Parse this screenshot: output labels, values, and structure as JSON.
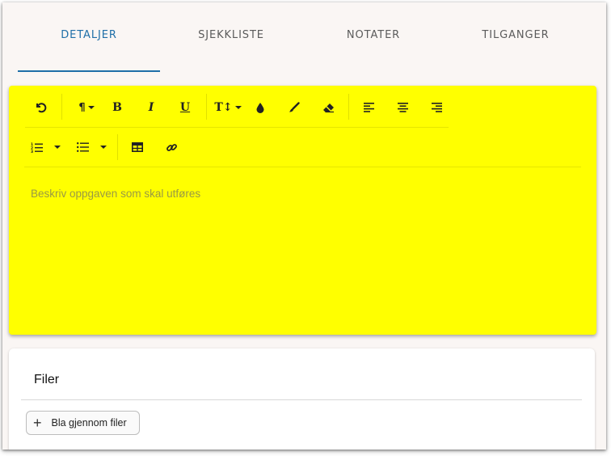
{
  "tabs": [
    {
      "label": "DETALJER",
      "active": true
    },
    {
      "label": "SJEKKLISTE",
      "active": false
    },
    {
      "label": "NOTATER",
      "active": false
    },
    {
      "label": "TILGANGER",
      "active": false
    }
  ],
  "editor": {
    "background": "#ffff00",
    "placeholder": "Beskriv oppgaven som skal utføres",
    "toolbar": {
      "row1": [
        "undo-icon",
        "paragraph-icon",
        "bold-icon",
        "italic-icon",
        "underline-icon",
        "font-size-icon",
        "text-color-icon",
        "highlight-icon",
        "eraser-icon",
        "align-left-icon",
        "align-center-icon",
        "align-right-icon"
      ],
      "row2": [
        "ordered-list-icon",
        "unordered-list-icon",
        "table-icon",
        "link-icon"
      ]
    }
  },
  "files": {
    "title": "Filer",
    "browse_label": "Bla gjennom filer"
  },
  "colors": {
    "accent": "#1f6fa8",
    "tab_text": "#5b5b5b"
  }
}
